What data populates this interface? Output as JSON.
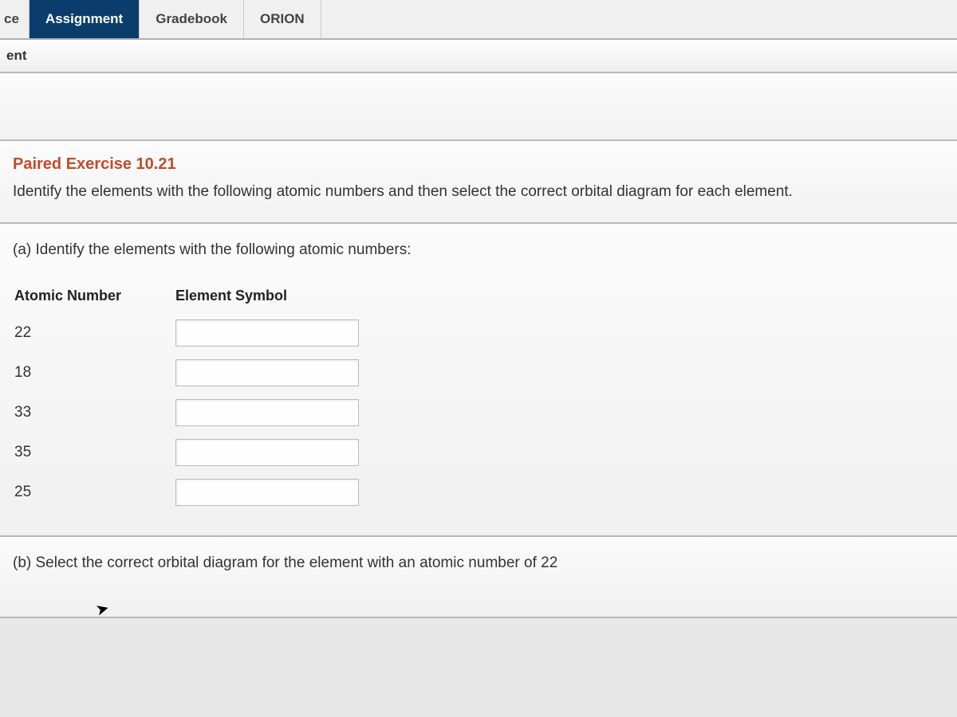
{
  "nav": {
    "tab_partial_left": "ce",
    "tab_assignment": "Assignment",
    "tab_gradebook": "Gradebook",
    "tab_orion": "ORION"
  },
  "subnav": {
    "label": "ent"
  },
  "question": {
    "title": "Paired Exercise 10.21",
    "description": "Identify the elements with the following atomic numbers and then select the correct orbital diagram for each element."
  },
  "part_a": {
    "label": "(a) Identify the elements with the following atomic numbers:",
    "table": {
      "header_number": "Atomic Number",
      "header_symbol": "Element Symbol",
      "rows": [
        {
          "number": "22",
          "value": ""
        },
        {
          "number": "18",
          "value": ""
        },
        {
          "number": "33",
          "value": ""
        },
        {
          "number": "35",
          "value": ""
        },
        {
          "number": "25",
          "value": ""
        }
      ]
    }
  },
  "part_b": {
    "label": "(b) Select the correct orbital diagram for the element with an atomic number of 22"
  }
}
